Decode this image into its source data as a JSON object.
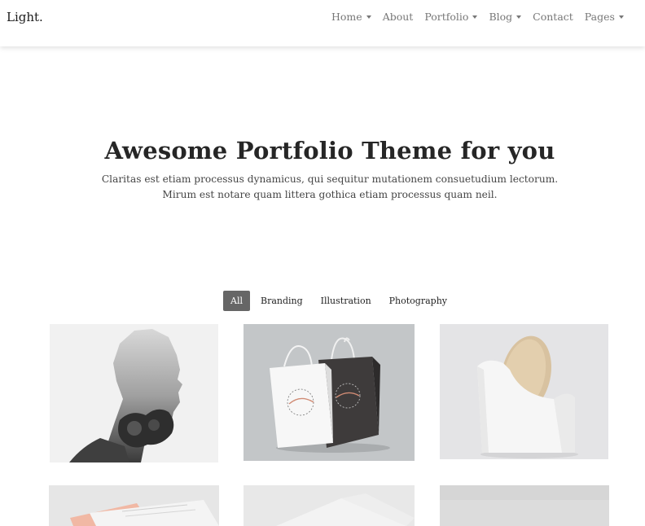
{
  "brand": "Light.",
  "nav": {
    "items": [
      {
        "label": "Home",
        "dropdown": true
      },
      {
        "label": "About",
        "dropdown": false
      },
      {
        "label": "Portfolio",
        "dropdown": true
      },
      {
        "label": "Blog",
        "dropdown": true
      },
      {
        "label": "Contact",
        "dropdown": false
      },
      {
        "label": "Pages",
        "dropdown": true
      }
    ]
  },
  "hero": {
    "title": "Awesome Portfolio Theme for you",
    "subtitle": "Claritas est etiam processus dynamicus, qui sequitur mutationem consuetudium lectorum. Mirum est notare quam littera gothica etiam processus quam neil."
  },
  "filters": {
    "active": "All",
    "items": [
      "All",
      "Branding",
      "Illustration",
      "Photography"
    ]
  },
  "portfolio": {
    "items": [
      {
        "image": "double-exposure-portrait"
      },
      {
        "image": "shopping-bag-mockup"
      },
      {
        "image": "ceramic-vase-mockup"
      },
      {
        "image": "stationery-mockup"
      },
      {
        "image": "paper-mockup"
      },
      {
        "image": "grey-mockup"
      }
    ]
  },
  "colors": {
    "active_filter_bg": "#666666",
    "nav_text": "#777777",
    "title_text": "#262626"
  }
}
